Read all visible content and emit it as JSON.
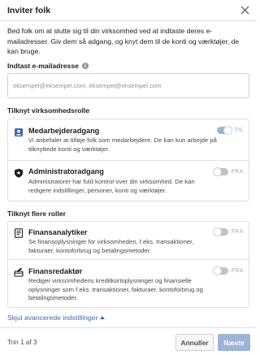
{
  "dialog": {
    "title": "Inviter folk",
    "intro": "Bed folk om at slutte sig til din virksomhed ved at indtaste deres e-mailadresser. Giv dem så adgang, og knyt dem til de konti og værktøjer, de kan bruge."
  },
  "email": {
    "label": "Indtast e-mailadresse",
    "value": "",
    "placeholder": "eksempel@eksempel.com, eksempel@eksempel.com"
  },
  "business_role": {
    "heading": "Tilknyt virksomhedsrolle",
    "items": [
      {
        "title": "Medarbejderadgang",
        "description": "Vi anbefaler at tilføje folk som medarbejdere. De kan kun arbejde på tilknyttede konti og værktøjer.",
        "toggle_label": "TIL",
        "toggle_on": true,
        "icon": "person-badge-icon"
      },
      {
        "title": "Administratoradgang",
        "description": "Administratorer har fuld kontrol over din virksomhed. De kan redigere indstillinger, personer, konti og værktøjer.",
        "toggle_label": "FRA",
        "toggle_on": false,
        "icon": "shield-star-icon"
      }
    ]
  },
  "more_roles": {
    "heading": "Tilknyt flere roller",
    "items": [
      {
        "title": "Finansanalytiker",
        "description": "Se finansoplysninger for virksomheden, f.eks. transaktioner, fakturaer, kontoforbrug og betalingsmetoder.",
        "toggle_label": "FRA",
        "toggle_on": false,
        "icon": "document-list-icon"
      },
      {
        "title": "Finansredaktør",
        "description": "Rediger virksomhedens kreditkortoplysninger og finansielle oplysninger som f.eks. transaktioner, fakturaer, kontoforbrug og betalingsmetoder.",
        "toggle_label": "FRA",
        "toggle_on": false,
        "icon": "pen-card-icon"
      }
    ]
  },
  "advanced_link": "Skjul avancerede indstillinger",
  "footer": {
    "step": "Trin 1 af 3",
    "cancel": "Annuller",
    "next": "Næste"
  },
  "colors": {
    "link": "#4267b2",
    "primary_disabled": "#9cb4d8",
    "border": "#dddfe2"
  }
}
